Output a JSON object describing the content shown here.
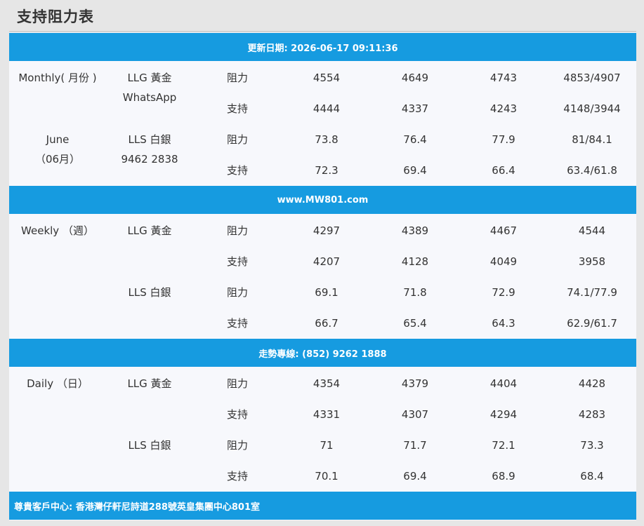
{
  "title": "支持阻力表",
  "bars": {
    "update": "更新日期: 2026-06-17 09:11:36",
    "website": "www.MW801.com",
    "hotline": "走勢專線: (852) 9262 1888",
    "address": "尊貴客戶中心: 香港灣仔軒尼詩道288號英皇集團中心801室"
  },
  "monthly": {
    "period_line1": "Monthly( 月份 )",
    "period_line2": "June",
    "period_line3": "（06月）",
    "gold_label": "LLG 黃金",
    "gold_sub": "WhatsApp",
    "silver_label": "LLS 白銀",
    "silver_sub": "9462 2838",
    "rows": [
      {
        "type": "阻力",
        "v1": "4554",
        "v2": "4649",
        "v3": "4743",
        "v4": "4853/4907"
      },
      {
        "type": "支持",
        "v1": "4444",
        "v2": "4337",
        "v3": "4243",
        "v4": "4148/3944"
      },
      {
        "type": "阻力",
        "v1": "73.8",
        "v2": "76.4",
        "v3": "77.9",
        "v4": "81/84.1"
      },
      {
        "type": "支持",
        "v1": "72.3",
        "v2": "69.4",
        "v3": "66.4",
        "v4": "63.4/61.8"
      }
    ]
  },
  "weekly": {
    "period": "Weekly （週）",
    "gold_label": "LLG 黃金",
    "silver_label": "LLS 白銀",
    "rows": [
      {
        "type": "阻力",
        "v1": "4297",
        "v2": "4389",
        "v3": "4467",
        "v4": "4544"
      },
      {
        "type": "支持",
        "v1": "4207",
        "v2": "4128",
        "v3": "4049",
        "v4": "3958"
      },
      {
        "type": "阻力",
        "v1": "69.1",
        "v2": "71.8",
        "v3": "72.9",
        "v4": "74.1/77.9"
      },
      {
        "type": "支持",
        "v1": "66.7",
        "v2": "65.4",
        "v3": "64.3",
        "v4": "62.9/61.7"
      }
    ]
  },
  "daily": {
    "period": "Daily （日）",
    "gold_label": "LLG 黃金",
    "silver_label": "LLS 白銀",
    "rows": [
      {
        "type": "阻力",
        "v1": "4354",
        "v2": "4379",
        "v3": "4404",
        "v4": "4428"
      },
      {
        "type": "支持",
        "v1": "4331",
        "v2": "4307",
        "v3": "4294",
        "v4": "4283"
      },
      {
        "type": "阻力",
        "v1": "71",
        "v2": "71.7",
        "v3": "72.1",
        "v4": "73.3"
      },
      {
        "type": "支持",
        "v1": "70.1",
        "v2": "69.4",
        "v3": "68.9",
        "v4": "68.4"
      }
    ]
  }
}
